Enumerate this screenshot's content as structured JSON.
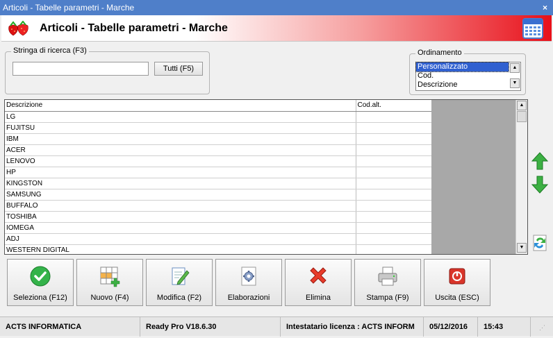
{
  "window": {
    "title": "Articoli - Tabelle parametri - Marche",
    "close_glyph": "×"
  },
  "header": {
    "title": "Articoli - Tabelle parametri - Marche",
    "logo_icon": "strawberry-icon",
    "right_icon": "calendar-icon"
  },
  "search": {
    "label": "Stringa di ricerca (F3)",
    "value": "",
    "placeholder": "",
    "all_button": "Tutti (F5)"
  },
  "ordering": {
    "label": "Ordinamento",
    "options": [
      "Personalizzato",
      "Cod.",
      "Descrizione"
    ],
    "selected": "Personalizzato"
  },
  "table": {
    "columns": [
      "Descrizione",
      "Cod.alt."
    ],
    "rows": [
      [
        "LG",
        ""
      ],
      [
        "FUJITSU",
        ""
      ],
      [
        "IBM",
        ""
      ],
      [
        "ACER",
        ""
      ],
      [
        "LENOVO",
        ""
      ],
      [
        "HP",
        ""
      ],
      [
        "KINGSTON",
        ""
      ],
      [
        "SAMSUNG",
        ""
      ],
      [
        "BUFFALO",
        ""
      ],
      [
        "TOSHIBA",
        ""
      ],
      [
        "IOMEGA",
        ""
      ],
      [
        "ADJ",
        ""
      ],
      [
        "WESTERN DIGITAL",
        ""
      ]
    ]
  },
  "side_buttons": {
    "up_icon": "arrow-up-icon",
    "down_icon": "arrow-down-icon",
    "refresh_icon": "refresh-icon"
  },
  "actions": [
    {
      "label": "Seleziona (F12)",
      "icon": "check-icon"
    },
    {
      "label": "Nuovo (F4)",
      "icon": "new-grid-icon"
    },
    {
      "label": "Modifica (F2)",
      "icon": "edit-icon"
    },
    {
      "label": "Elaborazioni",
      "icon": "gear-icon"
    },
    {
      "label": "Elimina",
      "icon": "delete-icon"
    },
    {
      "label": "Stampa (F9)",
      "icon": "printer-icon"
    },
    {
      "label": "Uscita (ESC)",
      "icon": "exit-icon"
    }
  ],
  "status": {
    "company": "ACTS INFORMATICA",
    "version": "Ready Pro V18.6.30",
    "license": "Intestatario licenza : ACTS INFORM",
    "date": "05/12/2016",
    "time": "15:43"
  },
  "colors": {
    "titlebar": "#4f7fc9",
    "selection": "#3060d0",
    "accent_red": "#e8101a"
  }
}
